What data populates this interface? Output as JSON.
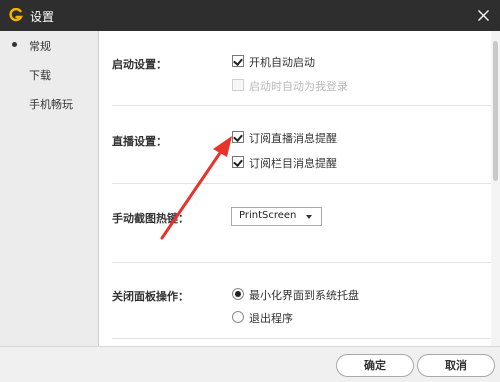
{
  "window": {
    "title": "设置"
  },
  "sidebar": {
    "items": [
      {
        "label": "常规"
      },
      {
        "label": "下载"
      },
      {
        "label": "手机畅玩"
      }
    ]
  },
  "sections": {
    "startup": {
      "label": "启动设置：",
      "options": [
        {
          "label": "开机自动启动",
          "checked": true,
          "enabled": true
        },
        {
          "label": "启动时自动为我登录",
          "checked": false,
          "enabled": false
        }
      ]
    },
    "live": {
      "label": "直播设置：",
      "options": [
        {
          "label": "订阅直播消息提醒",
          "checked": true
        },
        {
          "label": "订阅栏目消息提醒",
          "checked": true
        }
      ]
    },
    "screenshot": {
      "label": "手动截图热键：",
      "hotkey": "PrintScreen"
    },
    "close_panel": {
      "label": "关闭面板操作：",
      "options": [
        {
          "label": "最小化界面到系统托盘",
          "selected": true
        },
        {
          "label": "退出程序",
          "selected": false
        }
      ]
    }
  },
  "footer": {
    "ok_label": "确定",
    "cancel_label": "取消"
  },
  "colors": {
    "titlebar": "#2e2e2e",
    "logo": "#f5b400",
    "annotation_arrow": "#e8332a"
  }
}
